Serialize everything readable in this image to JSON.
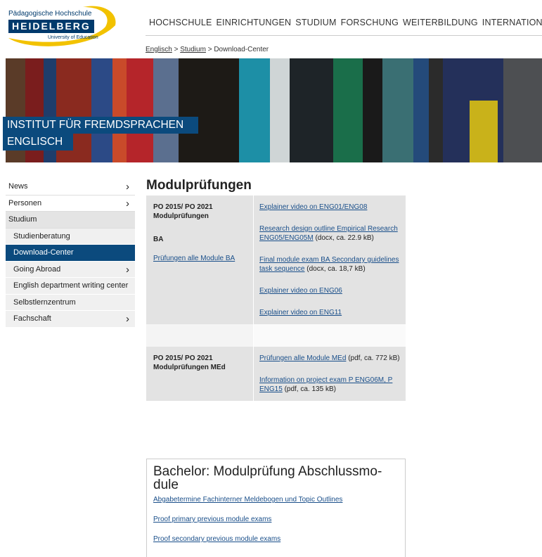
{
  "logo": {
    "top_text": "Pädagogische Hochschule",
    "main_text": "HEIDELBERG",
    "sub_text": "University of Education"
  },
  "topnav": [
    "HOCHSCHULE",
    "EINRICHTUNGEN",
    "STUDIUM",
    "FORSCHUNG",
    "WEITERBILDUNG",
    "INTERNATIONAL"
  ],
  "breadcrumb": {
    "item1": "Englisch",
    "sep1": ">",
    "item2": "Studium",
    "sep2": ">",
    "item3": "Download-Center"
  },
  "banner": {
    "line1": "INSTITUT FÜR FREMDSPRACHEN",
    "line2": "ENGLISCH"
  },
  "sidebar": {
    "items": [
      {
        "label": "News",
        "arrow": "›"
      },
      {
        "label": "Personen",
        "arrow": "›"
      },
      {
        "label": "Studium"
      },
      {
        "label": "Studienberatung"
      },
      {
        "label": "Download-Center"
      },
      {
        "label": "Going Abroad",
        "arrow": "›"
      },
      {
        "label": "English department writing center"
      },
      {
        "label": "Selbstlernzentrum"
      },
      {
        "label": "Fachschaft",
        "arrow": "›"
      }
    ]
  },
  "main": {
    "title": "Modulprüfungen",
    "ba": {
      "heading1": "PO 2015/ PO 2021",
      "heading2": "Modulprüfungen",
      "label": "BA",
      "link_all": "Prüfungen alle Module BA",
      "links": [
        {
          "text": "Explainer video on ENG01/ENG08",
          "suffix": ""
        },
        {
          "text": "Research design outline Empirical Research ENG05/ENG05M",
          "suffix": " (docx, ca. 22.9 kB)"
        },
        {
          "text": "Final module exam BA Secondary guidelines task sequence",
          "suffix": " (docx, ca. 18,7 kB)"
        },
        {
          "text": "Explainer video on ENG06",
          "suffix": ""
        },
        {
          "text": "Explainer video on ENG11",
          "suffix": ""
        }
      ]
    },
    "med": {
      "heading1": "PO 2015/ PO 2021",
      "heading2": "Modulprüfungen MEd",
      "links": [
        {
          "text": "Prüfungen alle Module MEd",
          "suffix": " (pdf, ca. 772 kB)"
        },
        {
          "text": "Information on project exam P ENG06M, P ENG15",
          "suffix": " (pdf, ca. 135 kB)"
        }
      ]
    },
    "bachelor": {
      "title": "Bachelor: Modulprüfung Abschlussmo-dule",
      "links": [
        "Abgabetermine Fachinterner Meldebogen und Topic Outlines",
        "Proof primary previous module exams",
        "Proof secondary previous module exams"
      ]
    }
  },
  "colors": {
    "brand_blue": "#0b4a7d",
    "logo_yellow": "#f2c200",
    "link": "#1a4f8a",
    "panel_gray": "#e3e3e3"
  }
}
